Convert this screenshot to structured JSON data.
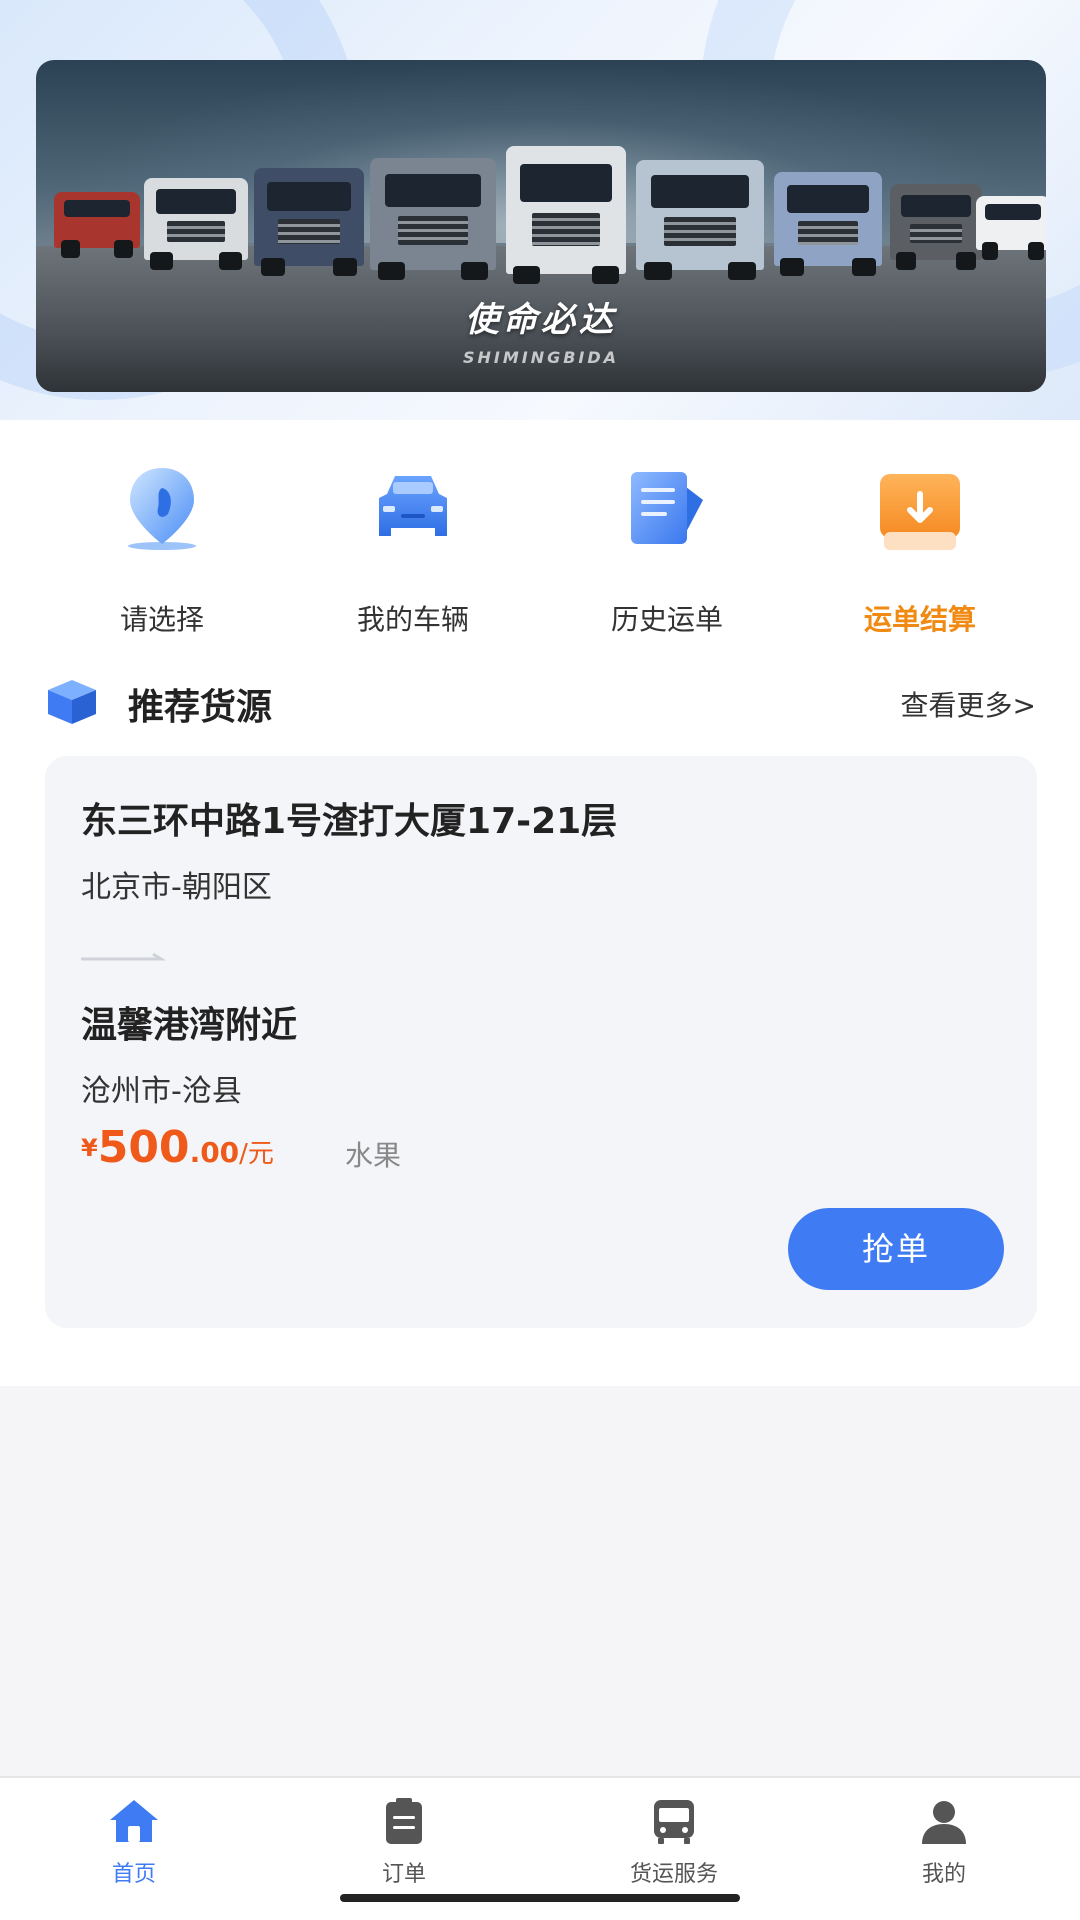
{
  "banner": {
    "title": "使命必达",
    "subtitle": "SHIMINGBIDA"
  },
  "quick_menu": [
    {
      "label": "请选择",
      "icon": "location-pin-icon",
      "active": false
    },
    {
      "label": "我的车辆",
      "icon": "car-icon",
      "active": false
    },
    {
      "label": "历史运单",
      "icon": "document-list-icon",
      "active": false
    },
    {
      "label": "运单结算",
      "icon": "download-box-icon",
      "active": true
    }
  ],
  "section": {
    "title": "推荐货源",
    "more": "查看更多>",
    "icon": "package-box-icon"
  },
  "cargo_card": {
    "from_title": "东三环中路1号渣打大厦17-21层",
    "from_city": "北京市-朝阳区",
    "to_title": "温馨港湾附近",
    "to_city": "沧州市-沧县",
    "price_currency": "¥",
    "price_integer": "500",
    "price_decimal": ".00",
    "price_unit": "/元",
    "cargo_type": "水果",
    "grab_button": "抢单"
  },
  "tabbar": [
    {
      "label": "首页",
      "icon": "home-icon",
      "active": true
    },
    {
      "label": "订单",
      "icon": "clipboard-icon",
      "active": false
    },
    {
      "label": "货运服务",
      "icon": "bus-icon",
      "active": false
    },
    {
      "label": "我的",
      "icon": "user-icon",
      "active": false
    }
  ],
  "colors": {
    "accent_blue": "#3f7cf4",
    "active_orange": "#f08a12",
    "price_orange": "#ef5a1a"
  }
}
